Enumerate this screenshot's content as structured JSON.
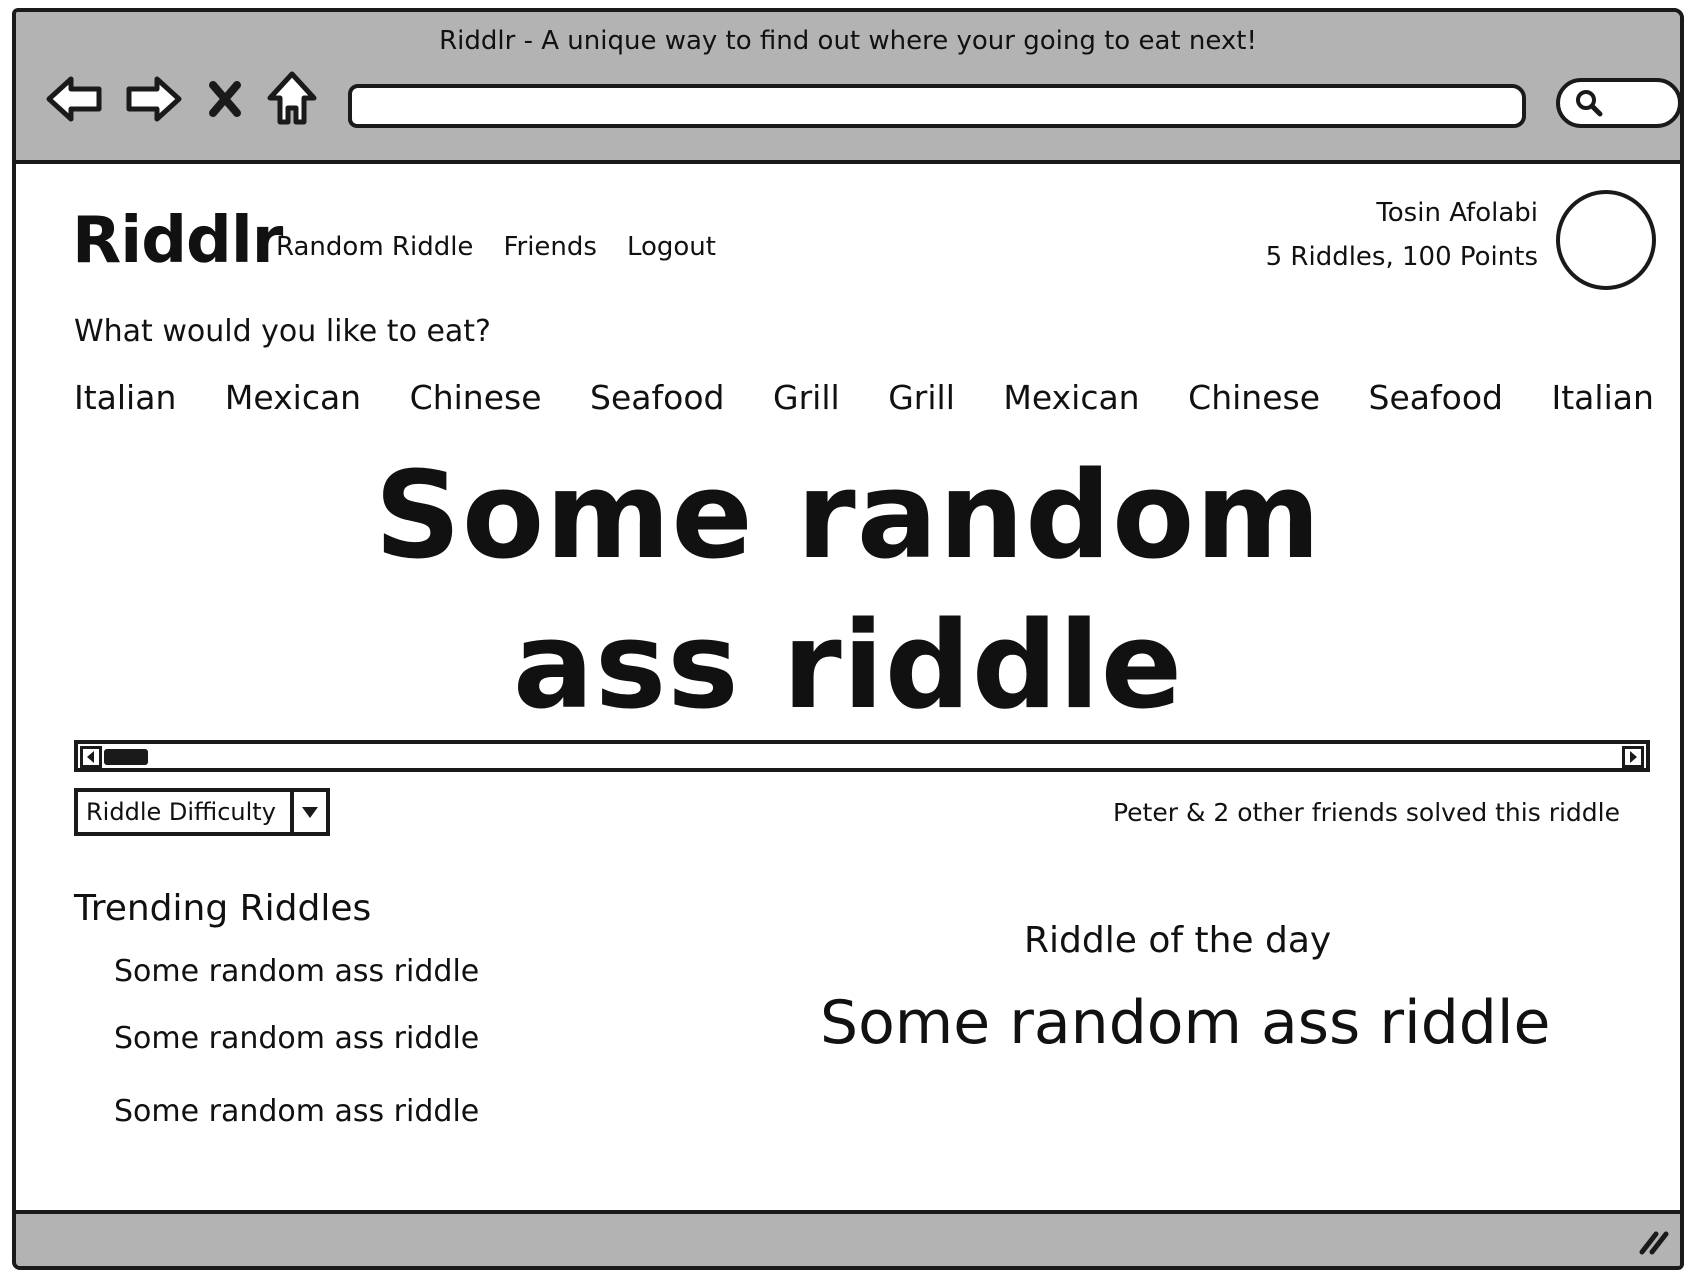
{
  "browser": {
    "window_title": "Riddlr - A unique way to find out where your going to eat next!",
    "url": "",
    "nav_icons": [
      "back-arrow-icon",
      "forward-arrow-icon",
      "close-icon",
      "home-icon"
    ],
    "search_icon": "search-icon"
  },
  "header": {
    "logo": "Riddlr",
    "nav": [
      "Random Riddle",
      "Friends",
      "Logout"
    ],
    "user_name": "Tosin Afolabi",
    "user_stats": "5 Riddles, 100 Points"
  },
  "prompt": "What would you like to eat?",
  "categories": [
    "Italian",
    "Mexican",
    "Chinese",
    "Seafood",
    "Grill",
    "Grill",
    "Mexican",
    "Chinese",
    "Seafood",
    "Italian"
  ],
  "main_riddle": {
    "line1": "Some random",
    "line2": "ass riddle"
  },
  "scroll_position": 0.0,
  "difficulty": {
    "label": "Riddle Difficulty"
  },
  "friends_solved": "Peter & 2 other friends solved this riddle",
  "trending": {
    "title": "Trending Riddles",
    "items": [
      "Some random ass riddle",
      "Some random ass riddle",
      "Some random ass riddle"
    ]
  },
  "riddle_of_the_day": {
    "title": "Riddle of the day",
    "text": "Some random ass riddle"
  }
}
